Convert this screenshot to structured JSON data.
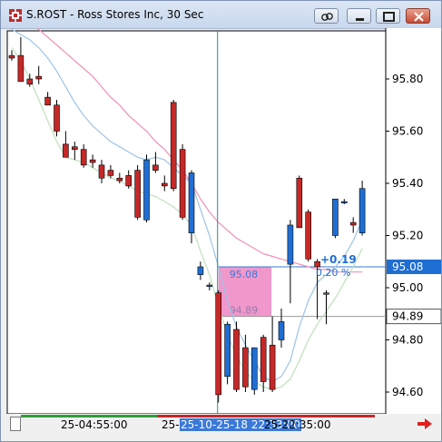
{
  "window": {
    "title": "S.ROST - Ross Stores Inc, 30 Sec",
    "colors": {
      "accent": "#3b79d8",
      "close": "#c64b35"
    }
  },
  "chart_data": {
    "type": "candlestick",
    "title": "",
    "xlabel": "",
    "ylabel": "",
    "ylim": [
      94.5,
      96.05
    ],
    "yticks": [
      "95.80",
      "95.60",
      "95.40",
      "95.20",
      "95.00",
      "94.80",
      "94.60"
    ],
    "xtick_labels": [
      "25-04:55:00",
      "25-10-25-18 22:33:00",
      "25-22:35:00"
    ],
    "grid": false,
    "candles": [
      {
        "o": 95.89,
        "h": 95.91,
        "l": 95.87,
        "c": 95.88
      },
      {
        "o": 95.89,
        "h": 95.96,
        "l": 95.79,
        "c": 95.79
      },
      {
        "o": 95.8,
        "h": 95.82,
        "l": 95.77,
        "c": 95.78
      },
      {
        "o": 95.81,
        "h": 95.85,
        "l": 95.78,
        "c": 95.8
      },
      {
        "o": 95.73,
        "h": 95.75,
        "l": 95.7,
        "c": 95.7
      },
      {
        "o": 95.7,
        "h": 95.72,
        "l": 95.58,
        "c": 95.6
      },
      {
        "o": 95.55,
        "h": 95.6,
        "l": 95.5,
        "c": 95.5
      },
      {
        "o": 95.54,
        "h": 95.56,
        "l": 95.49,
        "c": 95.53
      },
      {
        "o": 95.53,
        "h": 95.55,
        "l": 95.46,
        "c": 95.47
      },
      {
        "o": 95.49,
        "h": 95.51,
        "l": 95.46,
        "c": 95.48
      },
      {
        "o": 95.47,
        "h": 95.49,
        "l": 95.4,
        "c": 95.42
      },
      {
        "o": 95.45,
        "h": 95.47,
        "l": 95.42,
        "c": 95.43
      },
      {
        "o": 95.42,
        "h": 95.44,
        "l": 95.4,
        "c": 95.41
      },
      {
        "o": 95.43,
        "h": 95.45,
        "l": 95.38,
        "c": 95.39
      },
      {
        "o": 95.45,
        "h": 95.47,
        "l": 95.26,
        "c": 95.27
      },
      {
        "o": 95.26,
        "h": 95.51,
        "l": 95.25,
        "c": 95.49
      },
      {
        "o": 95.47,
        "h": 95.52,
        "l": 95.44,
        "c": 95.45
      },
      {
        "o": 95.4,
        "h": 95.43,
        "l": 95.37,
        "c": 95.39
      },
      {
        "o": 95.71,
        "h": 95.72,
        "l": 95.37,
        "c": 95.38
      },
      {
        "o": 95.53,
        "h": 95.55,
        "l": 95.26,
        "c": 95.27
      },
      {
        "o": 95.21,
        "h": 95.45,
        "l": 95.17,
        "c": 95.44
      },
      {
        "o": 95.05,
        "h": 95.1,
        "l": 95.03,
        "c": 95.08
      },
      {
        "o": 95.01,
        "h": 95.02,
        "l": 94.99,
        "c": 95.01
      },
      {
        "o": 94.98,
        "h": 94.99,
        "l": 94.56,
        "c": 94.59
      },
      {
        "o": 94.66,
        "h": 94.87,
        "l": 94.63,
        "c": 94.86
      },
      {
        "o": 94.84,
        "h": 94.87,
        "l": 94.6,
        "c": 94.61
      },
      {
        "o": 94.77,
        "h": 94.82,
        "l": 94.6,
        "c": 94.62
      },
      {
        "o": 94.61,
        "h": 94.77,
        "l": 94.59,
        "c": 94.77
      },
      {
        "o": 94.81,
        "h": 94.82,
        "l": 94.6,
        "c": 94.64
      },
      {
        "o": 94.78,
        "h": 94.89,
        "l": 94.6,
        "c": 94.61
      },
      {
        "o": 94.8,
        "h": 94.92,
        "l": 94.77,
        "c": 94.87
      },
      {
        "o": 95.09,
        "h": 95.26,
        "l": 94.94,
        "c": 95.24
      },
      {
        "o": 95.42,
        "h": 95.43,
        "l": 95.23,
        "c": 95.23
      },
      {
        "o": 95.29,
        "h": 95.3,
        "l": 95.1,
        "c": 95.11
      },
      {
        "o": 95.1,
        "h": 95.11,
        "l": 94.88,
        "c": 95.08
      },
      {
        "o": 94.98,
        "h": 94.99,
        "l": 94.86,
        "c": 94.98
      },
      {
        "o": 95.2,
        "h": 95.34,
        "l": 95.19,
        "c": 95.34
      },
      {
        "o": 95.33,
        "h": 95.34,
        "l": 95.32,
        "c": 95.33
      },
      {
        "o": 95.25,
        "h": 95.27,
        "l": 95.21,
        "c": 95.24
      },
      {
        "o": 95.21,
        "h": 95.41,
        "l": 95.2,
        "c": 95.38
      }
    ],
    "ma_blue": [
      95.99,
      95.97,
      95.95,
      95.92,
      95.88,
      95.83,
      95.77,
      95.71,
      95.66,
      95.62,
      95.59,
      95.56,
      95.54,
      95.52,
      95.5,
      95.49,
      95.5,
      95.49,
      95.46,
      95.43,
      95.4,
      95.3,
      95.2,
      95.08,
      94.95,
      94.85,
      94.78,
      94.72,
      94.66,
      94.64,
      94.66,
      94.72,
      94.85,
      94.95,
      95.02,
      95.05,
      95.08,
      95.12,
      95.18,
      95.26
    ],
    "ma_green": [
      95.92,
      95.87,
      95.8,
      95.72,
      95.64,
      95.56,
      95.5,
      95.49,
      95.48,
      95.46,
      95.44,
      95.42,
      95.41,
      95.39,
      95.37,
      95.36,
      95.35,
      95.33,
      95.31,
      95.28,
      95.24,
      95.14,
      95.05,
      94.93,
      94.82,
      94.74,
      94.68,
      94.64,
      94.62,
      94.61,
      94.62,
      94.65,
      94.72,
      94.8,
      94.86,
      94.91,
      94.96,
      95.02,
      95.08,
      95.15
    ],
    "ma_pink": [
      96.06,
      96.04,
      96.02,
      95.99,
      95.96,
      95.93,
      95.9,
      95.87,
      95.84,
      95.81,
      95.77,
      95.73,
      95.7,
      95.66,
      95.63,
      95.6,
      95.56,
      95.53,
      95.49,
      95.45,
      95.4,
      95.34,
      95.29,
      95.25,
      95.22,
      95.19,
      95.17,
      95.15,
      95.13,
      95.12,
      95.11,
      95.1,
      95.09,
      95.08,
      95.07,
      95.07,
      95.06,
      95.06,
      95.06,
      95.06
    ],
    "crosshair_x_index": 23,
    "price_box": {
      "label_top": "95.08",
      "label_bottom": "94.89",
      "top": 95.08,
      "bottom": 94.89
    },
    "annotation": {
      "change": "+0.19",
      "change_pct": "0.20 %"
    },
    "last_price": "95.08",
    "cursor_price": "94.89"
  }
}
